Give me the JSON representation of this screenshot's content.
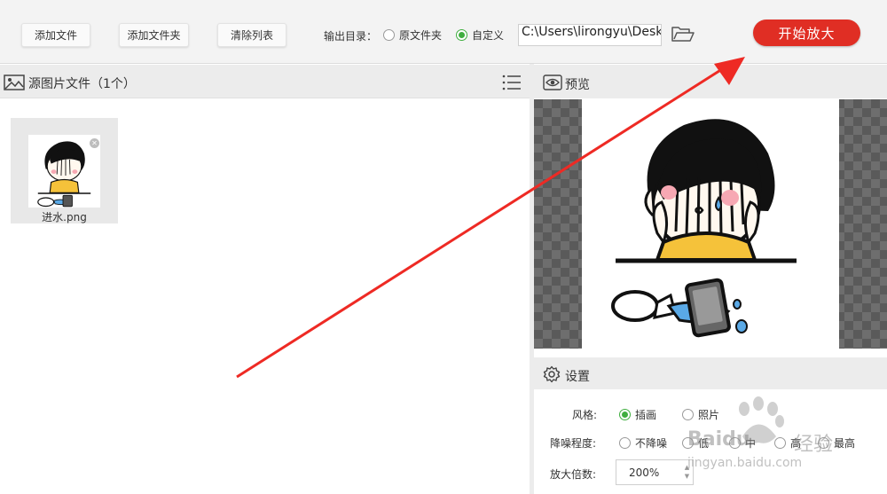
{
  "toolbar": {
    "add_file": "添加文件",
    "add_folder": "添加文件夹",
    "clear_list": "清除列表",
    "output_dir_label": "输出目录：",
    "option_original": "原文件夹",
    "option_custom": "自定义",
    "output_path": "C:\\Users\\lirongyu\\Desk",
    "start_label": "开始放大",
    "selected_option": "自定义"
  },
  "left_panel": {
    "title": "源图片文件（1个）",
    "files": [
      {
        "name": "进水.png"
      }
    ]
  },
  "preview": {
    "title": "预览"
  },
  "settings": {
    "title": "设置",
    "style_label": "风格:",
    "style_options": [
      "插画",
      "照片"
    ],
    "style_selected": "插画",
    "noise_label": "降噪程度:",
    "noise_options": [
      "不降噪",
      "低",
      "中",
      "高",
      "最高"
    ],
    "scale_label": "放大倍数:",
    "scale_value": "200%"
  },
  "watermark": {
    "brand": "Baidu",
    "brand_cn": "经验",
    "url": "jingyan.baidu.com"
  },
  "colors": {
    "accent_red": "#e02e24",
    "radio_green": "#3fae3f",
    "annotation_red": "#ee2a24"
  }
}
